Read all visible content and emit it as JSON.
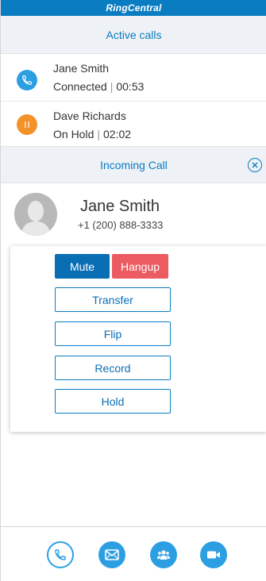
{
  "brand": {
    "logo_text": "RingCentral"
  },
  "active_calls": {
    "header": "Active calls",
    "calls": [
      {
        "name": "Jane Smith",
        "status": "Connected",
        "separator": "|",
        "time": "00:53",
        "icon": "phone-icon",
        "color": "#2c9fe3"
      },
      {
        "name": "Dave Richards",
        "status": "On Hold",
        "separator": "|",
        "time": "02:02",
        "icon": "pause-icon",
        "color": "#f4922a"
      }
    ]
  },
  "incoming": {
    "header": "Incoming Call",
    "close_icon": "close-circle-icon",
    "caller_name": "Jane Smith",
    "caller_number": "+1 (200) 888-3333"
  },
  "controls": {
    "mute": "Mute",
    "hangup": "Hangup",
    "transfer": "Transfer",
    "flip": "Flip",
    "record": "Record",
    "hold": "Hold"
  },
  "bottom_nav": {
    "items": [
      "phone-icon",
      "messages-icon",
      "contacts-icon",
      "video-icon"
    ]
  },
  "colors": {
    "brand_blue": "#0a7dc2",
    "accent_blue": "#2c9fe3",
    "hold_orange": "#f4922a",
    "hangup_red": "#ec5a62",
    "header_bg": "#eef1f5"
  }
}
